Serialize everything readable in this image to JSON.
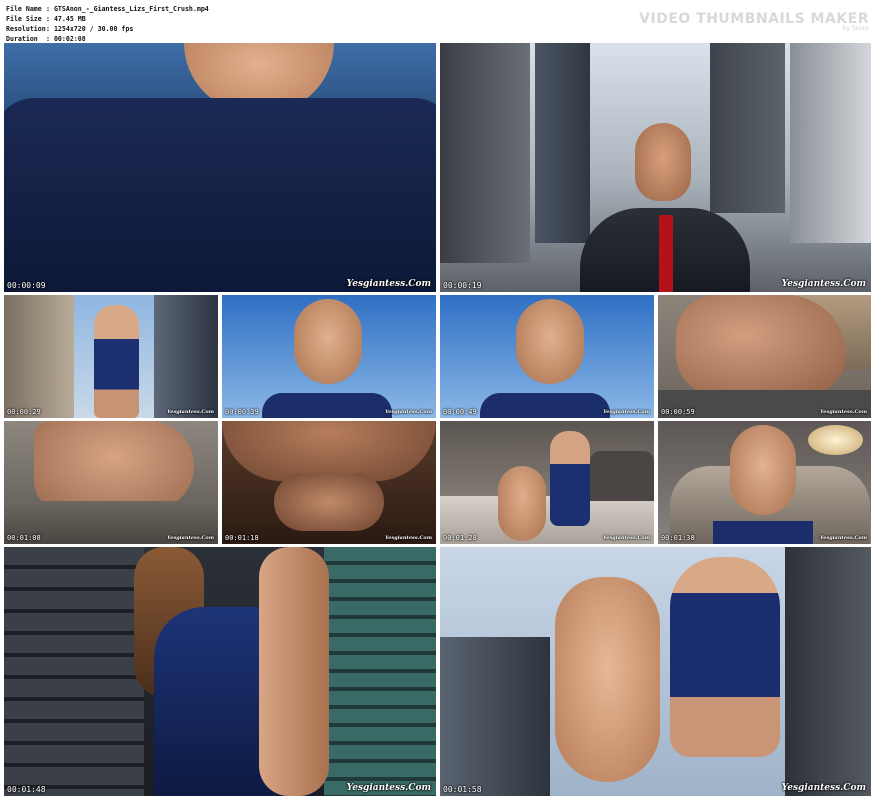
{
  "meta": {
    "rows": [
      {
        "key": "File Name",
        "value": ":  GTSAnon_-_Giantess_Lizs_First_Crush.mp4"
      },
      {
        "key": "File Size",
        "value": ":  47.45 MB"
      },
      {
        "key": "Resolution",
        "value": ":  1254x720 / 30.00 fps"
      },
      {
        "key": "Duration",
        "value": ":  00:02:08"
      }
    ]
  },
  "brand": {
    "name": "VIDEO THUMBNAILS MAKER",
    "sub": "by Scorp"
  },
  "watermark": "Yesgiantess.Com",
  "frames": [
    {
      "ts": "00:00:09"
    },
    {
      "ts": "00:00:19"
    },
    {
      "ts": "00:00:29"
    },
    {
      "ts": "00:00:39"
    },
    {
      "ts": "00:00:49"
    },
    {
      "ts": "00:00:59"
    },
    {
      "ts": "00:01:08"
    },
    {
      "ts": "00:01:18"
    },
    {
      "ts": "00:01:28"
    },
    {
      "ts": "00:01:38"
    },
    {
      "ts": "00:01:48"
    },
    {
      "ts": "00:01:58"
    }
  ]
}
